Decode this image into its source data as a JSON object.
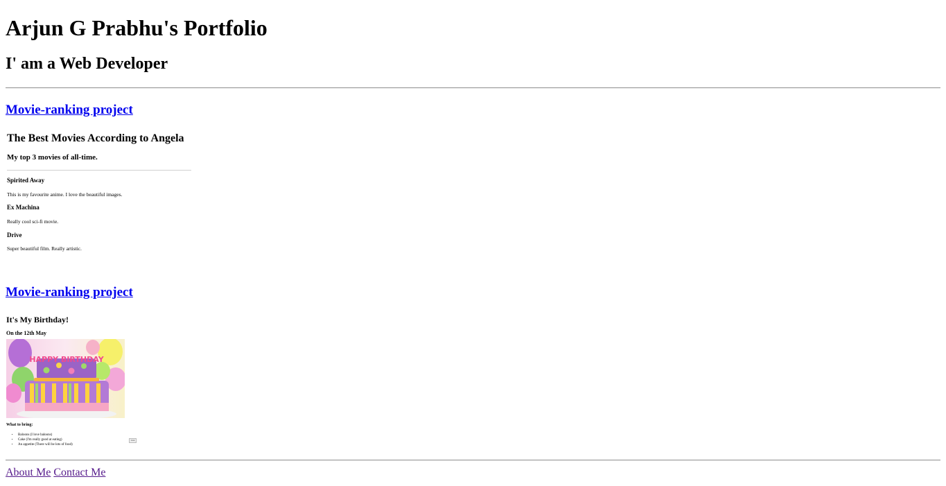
{
  "header": {
    "title": "Arjun G Prabhu's Portfolio",
    "subtitle": "I' am a Web Developer"
  },
  "projects": [
    {
      "link_label": "Movie-ranking project",
      "preview": {
        "title": "The Best Movies According to Angela",
        "subtitle": "My top 3 movies of all-time.",
        "movies": [
          {
            "name": "Spirited Away",
            "description": "This is my favourite anime. I love the beautiful images."
          },
          {
            "name": "Ex Machina",
            "description": "Really cool sci-fi movie."
          },
          {
            "name": "Drive",
            "description": "Super beautiful film. Really artistic."
          }
        ]
      }
    },
    {
      "link_label": "Movie-ranking project",
      "preview": {
        "title": "It's My Birthday!",
        "date": "On the 12th May",
        "cake_text": "HAPPY BIRTHDAY",
        "bring_label": "What to bring:",
        "items": [
          "Baloons (I love baloons)",
          "Cake (I'm really good at eating)",
          "An appetite (There will be lots of food)"
        ],
        "button_label": "Link"
      }
    }
  ],
  "footer": {
    "about_label": "About Me",
    "contact_label": "Contact Me"
  },
  "colors": {
    "link": "#0000ee",
    "visited_link": "#551a8b",
    "rule": "#9a9a9a"
  }
}
